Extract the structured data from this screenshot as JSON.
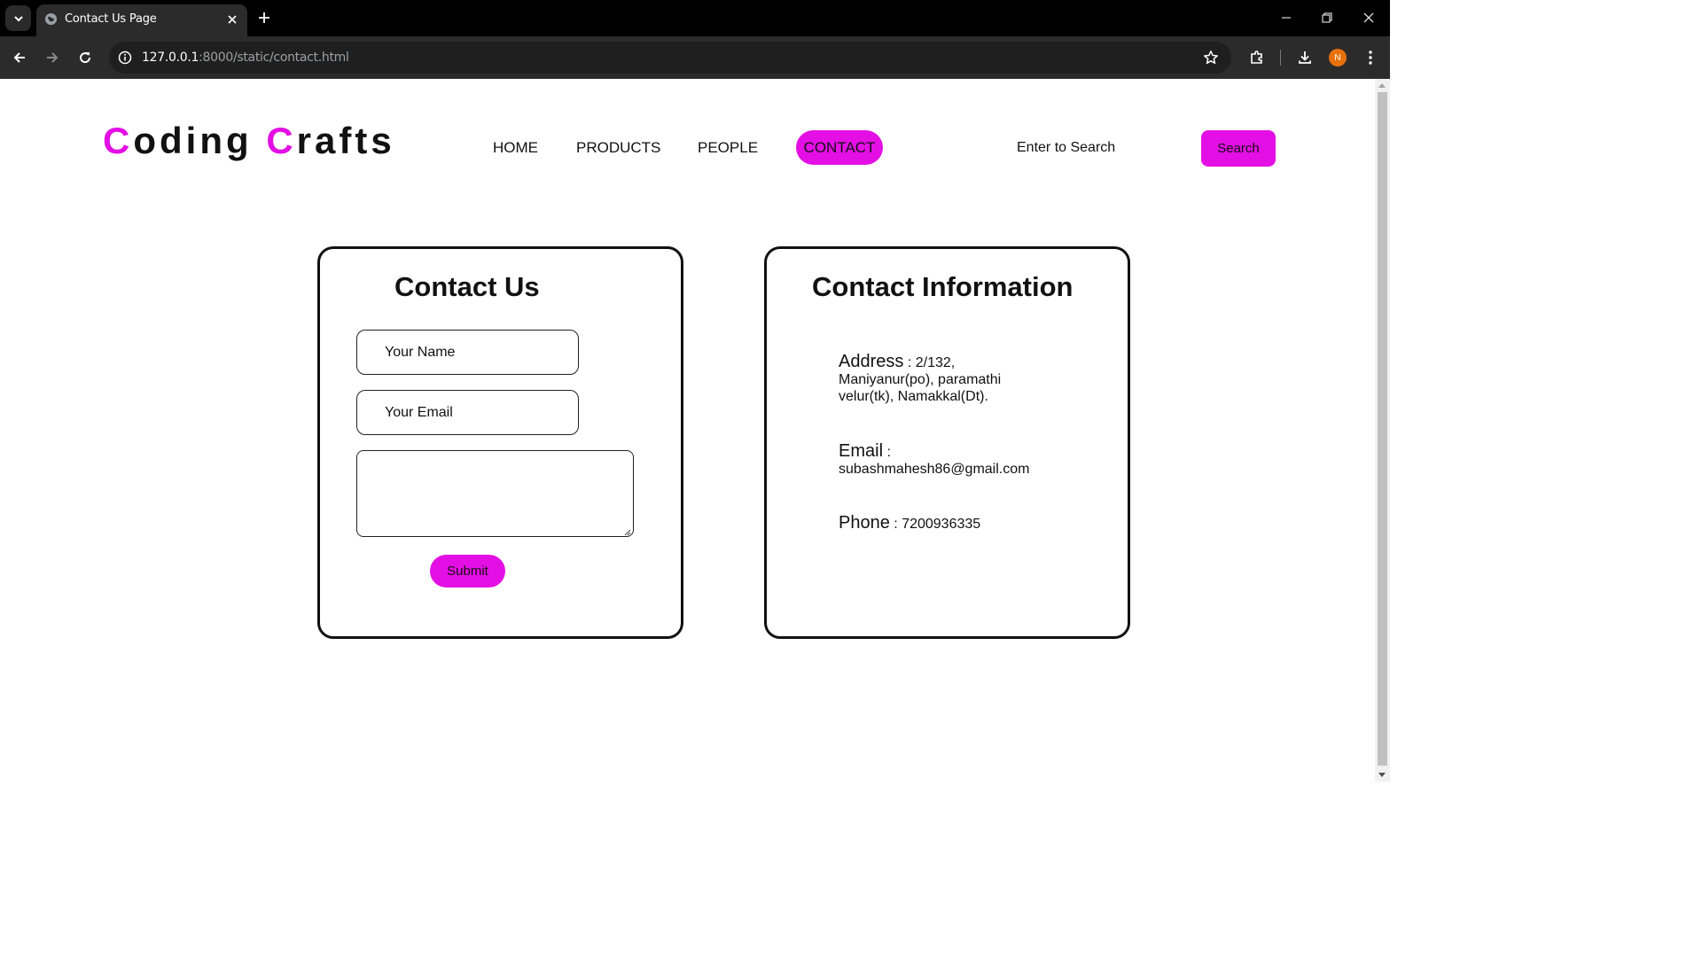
{
  "browser": {
    "tab_title": "Contact Us Page",
    "url_host": "127.0.0.1",
    "url_path": ":8000/static/contact.html",
    "profile_initial": "N"
  },
  "site": {
    "logo": {
      "first_initial": "C",
      "first_rest": "oding ",
      "second_initial": "C",
      "second_rest": "rafts",
      "accent_color": "#e40fe4"
    },
    "nav": {
      "home": "HOME",
      "products": "PRODUCTS",
      "people": "PEOPLE",
      "contact": "CONTACT"
    },
    "search": {
      "placeholder": "Enter to Search",
      "button": "Search"
    }
  },
  "contact_form": {
    "title": "Contact Us",
    "name_placeholder": "Your Name",
    "email_placeholder": "Your Email",
    "message_value": "",
    "submit_label": "Submit"
  },
  "contact_info": {
    "title": "Contact Information",
    "address_label": "Address",
    "address_value": "2/132, Maniyanur(po), paramathi velur(tk), Namakkal(Dt).",
    "email_label": "Email",
    "email_value": "subashmahesh86@gmail.com",
    "phone_label": "Phone",
    "phone_value": "7200936335",
    "separator": " : "
  }
}
